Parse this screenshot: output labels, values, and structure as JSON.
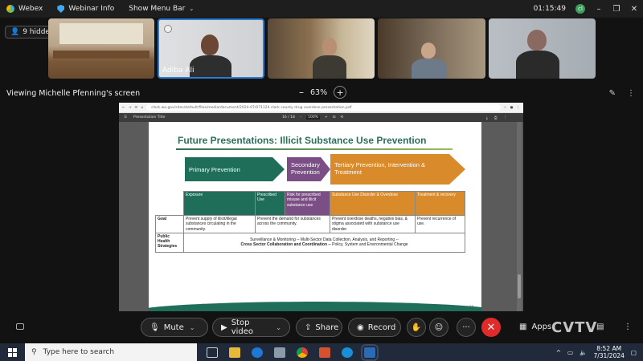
{
  "titlebar": {
    "app_name": "Webex",
    "webinar_info": "Webinar Info",
    "show_menu_bar": "Show Menu Bar",
    "timer": "01:15:49",
    "avatar_initial": "cl",
    "minimize": "–",
    "restore": "❐",
    "close": "✕"
  },
  "participants": {
    "hidden_count": "9 hidden",
    "tiles": [
      {
        "label": ""
      },
      {
        "label": "Adiba Ali"
      },
      {
        "label": ""
      },
      {
        "label": ""
      },
      {
        "label": ""
      }
    ]
  },
  "share": {
    "viewing_text": "Viewing Michelle Pfenning's screen",
    "zoom_out": "–",
    "zoom_level": "63%",
    "zoom_in": "+"
  },
  "browser": {
    "url": "clark.wa.gov/sites/default/files/media/document/2024-07/071124 clark county drug overdose presentation.pdf",
    "pdf_title": "Presentation Title",
    "page_indicator": "16 / 18",
    "pdf_zoom": "100%"
  },
  "slide": {
    "title": "Future Presentations: Illicit Substance Use Prevention",
    "arrows": {
      "primary": "Primary Prevention",
      "secondary": "Secondary Prevention",
      "tertiary": "Tertiary Prevention, Intervention & Treatment"
    },
    "table": {
      "headers": {
        "exposure": "Exposure",
        "prescribed": "Prescribed Use",
        "risk": "Risk for prescribed misuse and illicit substance use",
        "sud": "Substance Use Disorder & Overdose",
        "treatment": "Treatment & recovery"
      },
      "goal_label": "Goal",
      "goal": {
        "exposure": "Prevent supply of illicit/illegal substances circulating in the community.",
        "prescribed": "Prevent the demand for substances across the community.",
        "sud": "Prevent overdose deaths, negative bias, & stigma associated with substance use disorder.",
        "treatment": "Prevent recurrence of use."
      },
      "strategies_label": "Public Health Strategies",
      "strategies_line1": "Surveillance & Monitoring -- Multi-Sector Data Collection, Analysis, and Reporting --",
      "strategies_line2_bold": "Cross Sector Collaboration and Coordination --",
      "strategies_line2_rest": " Policy, System and Environmental Change"
    },
    "page_number": "16"
  },
  "controls": {
    "mute": "Mute",
    "stop_video": "Stop video",
    "share": "Share",
    "record": "Record",
    "more": "···",
    "end": "✕",
    "apps": "Apps",
    "watermark": "CVTV"
  },
  "taskbar": {
    "search_placeholder": "Type here to search",
    "time": "8:52 AM",
    "date": "7/31/2024"
  }
}
